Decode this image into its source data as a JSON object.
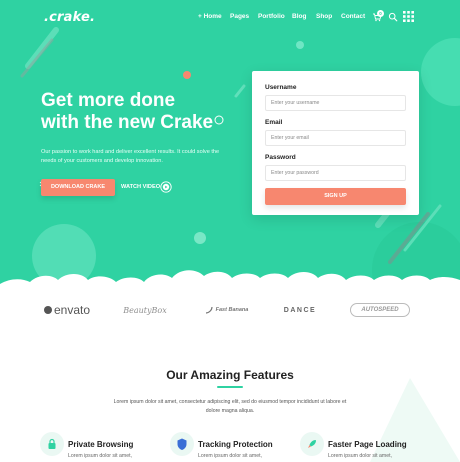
{
  "header": {
    "logo": ".crake.",
    "nav": [
      "+ Home",
      "Pages",
      "Portfolio",
      "Blog",
      "Shop",
      "Contact"
    ],
    "cart_count": "0",
    "icons": [
      "cart-icon",
      "search-icon",
      "grid-menu-icon"
    ]
  },
  "hero": {
    "headline_line1": "Get more done",
    "headline_line2": "with the new Crake",
    "subtext": "Our passion to work hard and deliver excellent results. It could solve the needs of your customers and develop innovation.",
    "download_label": "DOWNLOAD CRAKE",
    "watch_label": "WATCH VIDEO"
  },
  "form": {
    "username_label": "Username",
    "username_placeholder": "Enter your username",
    "email_label": "Email",
    "email_placeholder": "Enter your email",
    "password_label": "Password",
    "password_placeholder": "Enter your password",
    "signup_label": "SIGN UP"
  },
  "brands": {
    "envato": "envato",
    "beautybox": "BeautyBox",
    "fastbanana": "Fast Banana",
    "dance": "DANCE",
    "autospeed": "AUTOSPEED"
  },
  "features": {
    "title": "Our Amazing Features",
    "description": "Lorem ipsum dolor sit amet, consectetur adipiscing elit, sed do eiusmod tempor incididunt ut labore et dolore magna aliqua.",
    "items": [
      {
        "title": "Private Browsing",
        "text": "Lorem ipsum dolor sit amet,",
        "icon": "lock-icon"
      },
      {
        "title": "Tracking Protection",
        "text": "Lorem ipsum dolor sit amet,",
        "icon": "shield-icon"
      },
      {
        "title": "Faster Page Loading",
        "text": "Lorem ipsum dolor sit amet,",
        "icon": "rocket-icon"
      }
    ]
  },
  "colors": {
    "brand_green": "#2fd2a2",
    "accent_coral": "#f7876f"
  }
}
